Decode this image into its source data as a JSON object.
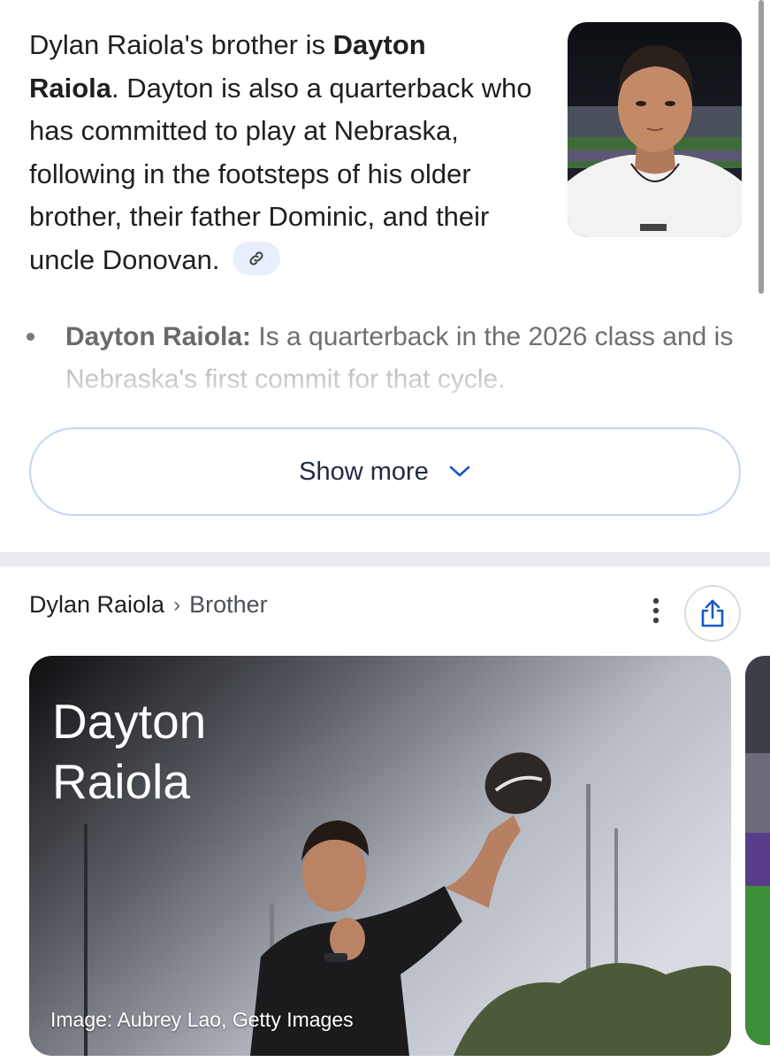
{
  "summary": {
    "part1": "Dylan Raiola's brother is ",
    "name_bold_1": "Dayton",
    "name_bold_2": "Raiola",
    "part2": ". Dayton is also a quarterback who has committed to play at Nebraska, following in the footsteps of his older brother, their father Dominic, and their uncle Donovan.",
    "link_icon": "link-icon"
  },
  "thumbnail": {
    "alt": "Photo of Dayton Raiola"
  },
  "bullet": {
    "term": "Dayton Raiola:",
    "text": " Is a quarterback in the 2026 class and is Nebraska's first commit for that cycle."
  },
  "show_more": {
    "label": "Show more",
    "icon": "chevron-down-icon"
  },
  "breadcrumb": {
    "root": "Dylan Raiola",
    "separator": "›",
    "current": "Brother"
  },
  "actions": {
    "more_icon": "more-vert-icon",
    "share_icon": "share-icon"
  },
  "card": {
    "title": "Dayton Raiola",
    "credit": "Image: Aubrey Lao, Getty Images"
  },
  "colors": {
    "accent_blue": "#1a56c8",
    "chip_bg": "#e8eefb",
    "outline": "#c5d6ef"
  }
}
